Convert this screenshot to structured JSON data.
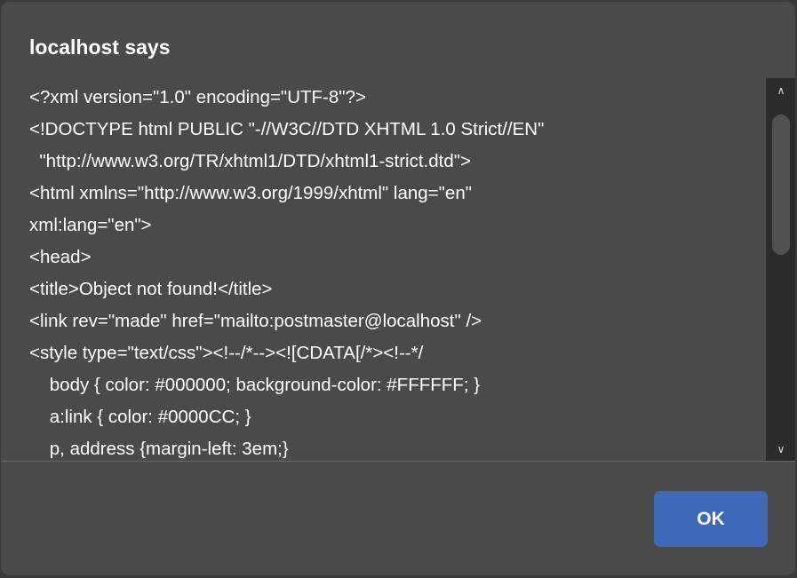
{
  "dialog": {
    "title": "localhost says",
    "message_lines": [
      "<?xml version=\"1.0\" encoding=\"UTF-8\"?>",
      "<!DOCTYPE html PUBLIC \"-//W3C//DTD XHTML 1.0 Strict//EN\"",
      "  \"http://www.w3.org/TR/xhtml1/DTD/xhtml1-strict.dtd\">",
      "<html xmlns=\"http://www.w3.org/1999/xhtml\" lang=\"en\"",
      "xml:lang=\"en\">",
      "<head>",
      "<title>Object not found!</title>",
      "<link rev=\"made\" href=\"mailto:postmaster@localhost\" />",
      "<style type=\"text/css\"><!--/*--><![CDATA[/*><!--*/",
      "    body { color: #000000; background-color: #FFFFFF; }",
      "    a:link { color: #0000CC; }",
      "    p, address {margin-left: 3em;}"
    ],
    "ok_label": "OK",
    "scroll_up_icon": "chevron-up-icon",
    "scroll_down_icon": "chevron-down-icon",
    "accent_color": "#3d6ab8"
  }
}
